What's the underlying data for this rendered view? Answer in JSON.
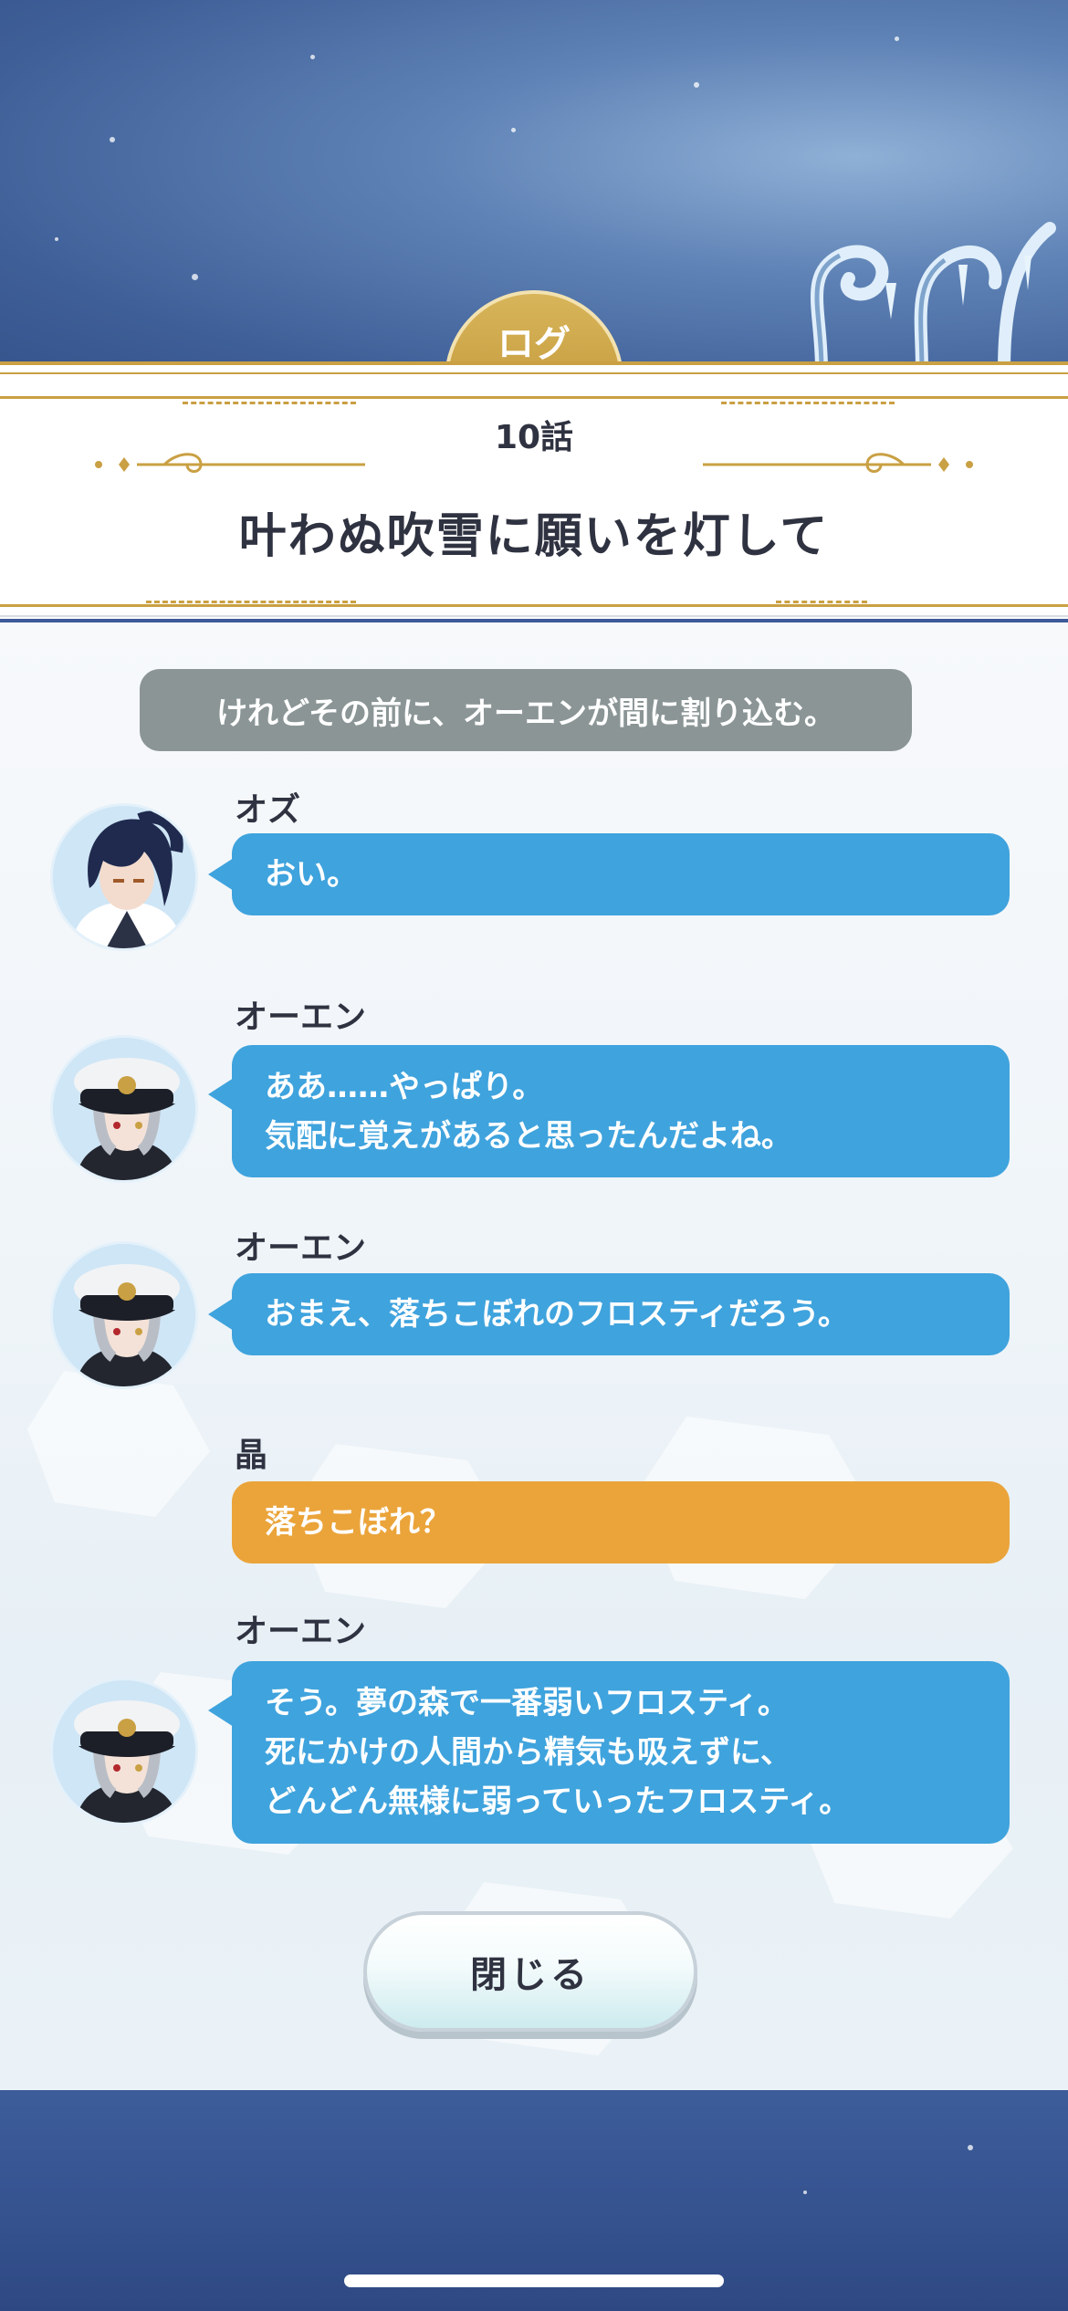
{
  "header": {
    "tab_label": "ログ",
    "episode": "10話",
    "title": "叶わぬ吹雪に願いを灯して"
  },
  "log": {
    "narration": "けれどその前に、オーエンが間に割り込む。",
    "entries": [
      {
        "speaker": "オズ",
        "lines": [
          "おい。"
        ],
        "color": "blue",
        "avatar": "oz-portrait"
      },
      {
        "speaker": "オーエン",
        "lines": [
          "ああ……やっぱり。",
          "気配に覚えがあると思ったんだよね。"
        ],
        "color": "blue",
        "avatar": "owen-portrait"
      },
      {
        "speaker": "オーエン",
        "lines": [
          "おまえ、落ちこぼれのフロスティだろう。"
        ],
        "color": "blue",
        "avatar": "owen-portrait"
      },
      {
        "speaker": "晶",
        "lines": [
          "落ちこぼれ？"
        ],
        "color": "orange",
        "avatar": null
      },
      {
        "speaker": "オーエン",
        "lines": [
          "そう。夢の森で一番弱いフロスティ。",
          "死にかけの人間から精気も吸えずに、",
          "どんどん無様に弱っていったフロスティ。"
        ],
        "color": "blue",
        "avatar": "owen-portrait"
      }
    ]
  },
  "close_button": {
    "label": "閉じる"
  },
  "colors": {
    "accent_gold": "#c9a043",
    "bubble_blue": "#3fa3dd",
    "bubble_orange": "#eba43a",
    "narration_gray": "#8b9596",
    "text_dark": "#2f3240"
  }
}
